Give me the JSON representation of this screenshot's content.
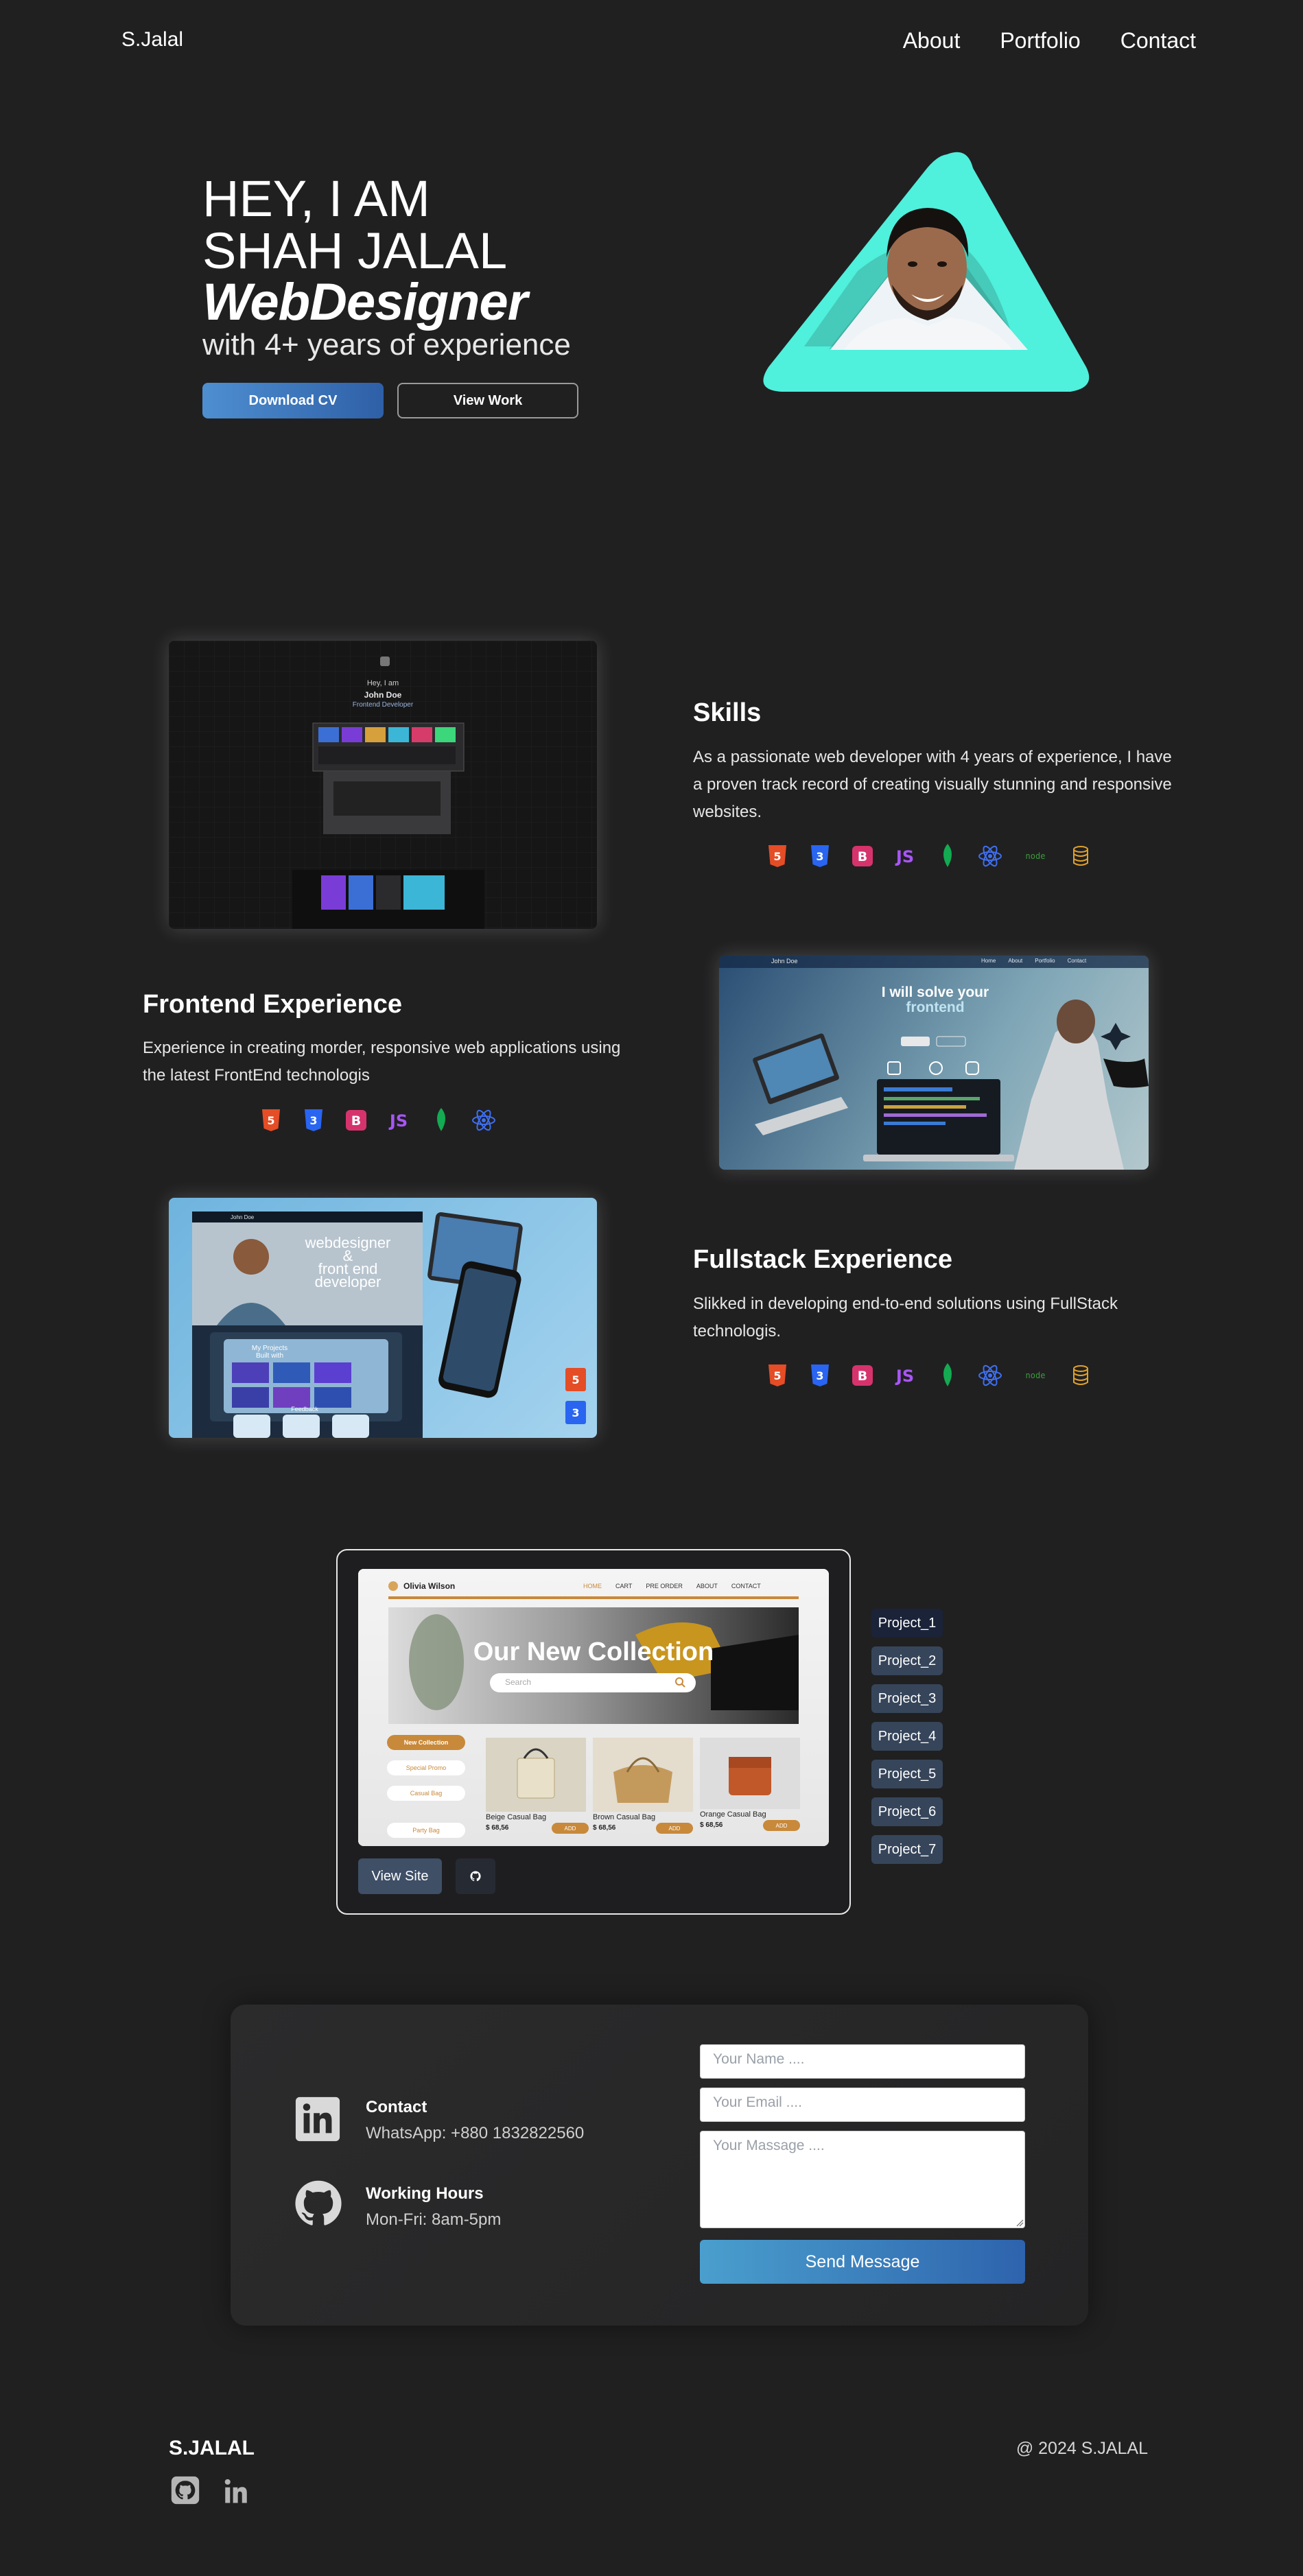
{
  "nav": {
    "brand": "S.Jalal",
    "links": [
      "About",
      "Portfolio",
      "Contact"
    ]
  },
  "hero": {
    "line1": "HEY, I AM",
    "line2": "SHAH JALAL",
    "line3": "WebDesigner",
    "line4": "with 4+ years of experience",
    "download_label": "Download CV",
    "view_work_label": "View Work",
    "accent_color": "#4ff0dc"
  },
  "skills": {
    "title": "Skills",
    "text": "As a passionate web developer with 4 years of experience, I have a proven track record of creating visually stunning and responsive websites.",
    "preview": {
      "greeting": "Hey, I am",
      "name": "John Doe",
      "role": "Frontend Developer"
    }
  },
  "frontend": {
    "title": "Frontend Experience",
    "text": "Experience in creating morder, responsive web applications using the latest FrontEnd technologis",
    "preview": {
      "brand": "John Doe",
      "menu": [
        "Home",
        "About",
        "Portfolio",
        "Contact"
      ],
      "heading_line1": "I will solve your",
      "heading_line2": "frontend"
    }
  },
  "fullstack": {
    "title": "Fullstack Experience",
    "text": "Slikked in developing end-to-end solutions using FullStack technologis.",
    "preview": {
      "brand": "John Doe",
      "hero_line1": "webdesigner",
      "hero_line2": "&",
      "hero_line3": "front end",
      "hero_line4": "developer",
      "projects_label": "My Projects",
      "projects_label2": "Built with",
      "feedback_label": "Feedback"
    }
  },
  "tech_icons": [
    "html5-icon",
    "css3-icon",
    "bootstrap-icon",
    "javascript-icon",
    "mongodb-icon",
    "react-icon",
    "nodejs-icon",
    "database-icon"
  ],
  "project": {
    "preview": {
      "brand": "Olivia Wilson",
      "menu": [
        "HOME",
        "CART",
        "PRE ORDER",
        "ABOUT",
        "CONTACT"
      ],
      "banner_title": "Our New Collection",
      "search_placeholder": "Search",
      "categories": [
        "New Collection",
        "Special Promo",
        "Casual Bag",
        "Party Bag"
      ],
      "products": [
        {
          "name": "Beige Casual Bag",
          "price": "$ 68,56",
          "button": "ADD"
        },
        {
          "name": "Brown Casual Bag",
          "price": "$ 68,56",
          "button": "ADD"
        },
        {
          "name": "Orange Casual Bag",
          "price": "$ 68,56",
          "button": "ADD"
        }
      ]
    },
    "view_site_label": "View Site",
    "list": [
      "Project_1",
      "Project_2",
      "Project_3",
      "Project_4",
      "Project_5",
      "Project_6",
      "Project_7"
    ]
  },
  "contact": {
    "item1_title": "Contact",
    "item1_sub": "WhatsApp: +880 1832822560",
    "item2_title": "Working Hours",
    "item2_sub": "Mon-Fri: 8am-5pm",
    "name_placeholder": "Your Name ....",
    "email_placeholder": "Your Email ....",
    "message_placeholder": "Your Massage ....",
    "send_label": "Send Message"
  },
  "footer": {
    "brand": "S.JALAL",
    "copyright": "@ 2024 S.JALAL"
  }
}
